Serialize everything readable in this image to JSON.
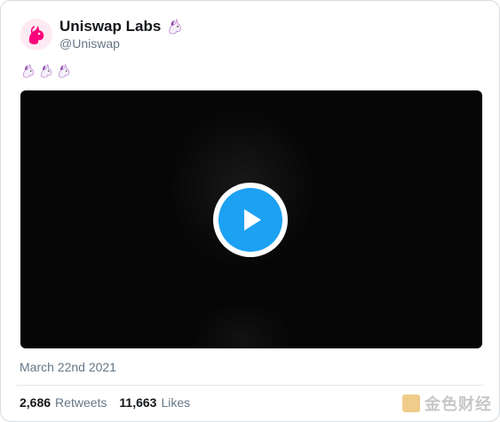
{
  "tweet": {
    "author_name": "Uniswap Labs",
    "author_handle": "@Uniswap",
    "body_emojis": [
      "unicorn",
      "unicorn",
      "unicorn"
    ],
    "date": "March 22nd 2021",
    "retweets_count": "2,686",
    "retweets_label": "Retweets",
    "likes_count": "11,663",
    "likes_label": "Likes",
    "icons": {
      "avatar": "uniswap-unicorn-logo",
      "name_emoji": "unicorn",
      "video_play": "play-icon"
    },
    "colors": {
      "name": "#14171a",
      "secondary": "#657786",
      "play_button": "#1da1f2",
      "avatar_bg": "#fdeaf2",
      "unicorn": "#ff007a"
    }
  },
  "watermark": {
    "text": "金色财经"
  }
}
